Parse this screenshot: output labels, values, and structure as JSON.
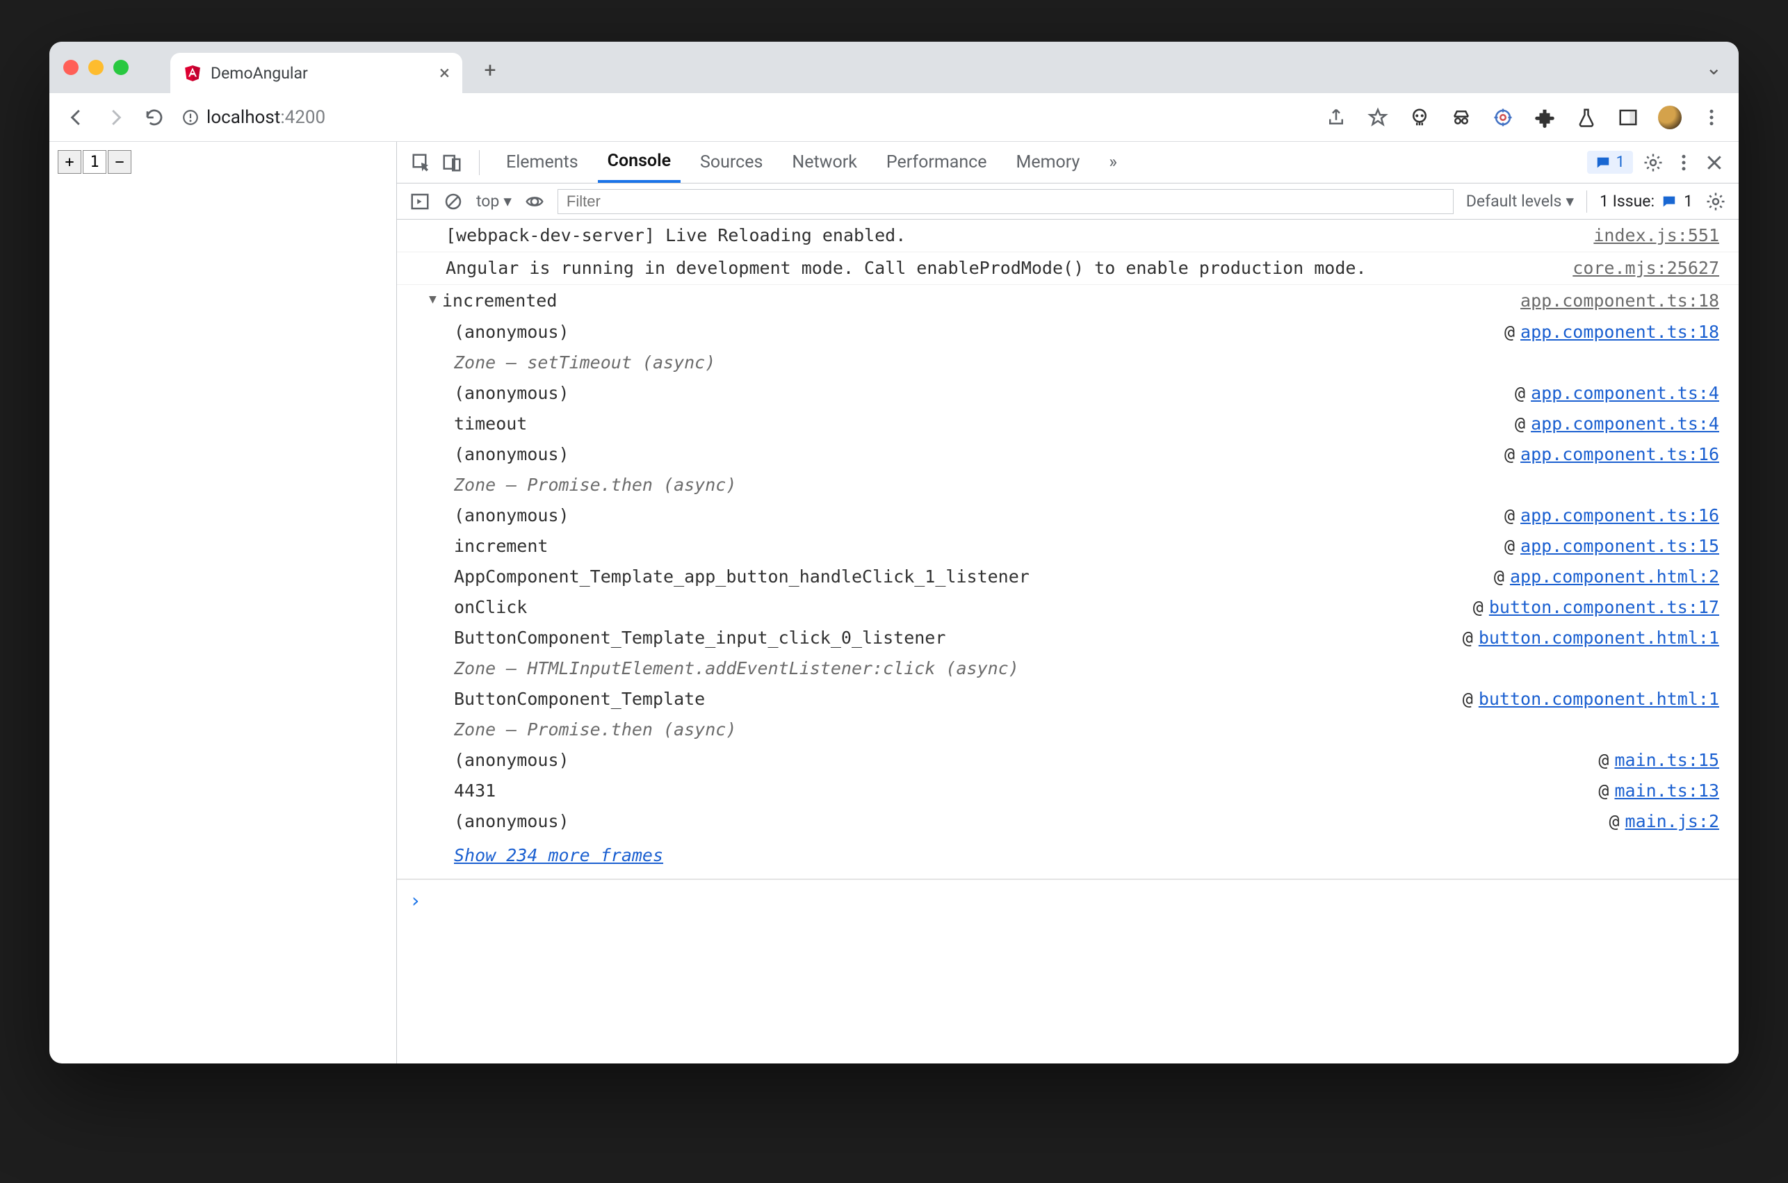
{
  "window": {
    "tab_title": "DemoAngular",
    "new_tab": "+",
    "close": "×",
    "collapse": "⌄"
  },
  "toolbar": {
    "url_prefix": "localhost",
    "url_suffix": ":4200"
  },
  "page": {
    "plus": "+",
    "value": "1",
    "minus": "−"
  },
  "devtools": {
    "tabs": [
      "Elements",
      "Console",
      "Sources",
      "Network",
      "Performance",
      "Memory"
    ],
    "active_tab": "Console",
    "more": "»",
    "msg_count": "1",
    "settings": "",
    "sub": {
      "context": "top",
      "filter_placeholder": "Filter",
      "levels": "Default levels",
      "issues_label": "1 Issue:",
      "issues_count": "1"
    },
    "log": [
      {
        "msg": "[webpack-dev-server] Live Reloading enabled.",
        "src": "index.js:551"
      },
      {
        "msg": "Angular is running in development mode. Call enableProdMode() to enable production mode.",
        "src": "core.mjs:25627"
      }
    ],
    "trace": {
      "title": "incremented",
      "src": "app.component.ts:18",
      "frames": [
        {
          "fn": "(anonymous)",
          "link": "app.component.ts:18"
        },
        {
          "note": "Zone — setTimeout (async)"
        },
        {
          "fn": "(anonymous)",
          "link": "app.component.ts:4"
        },
        {
          "fn": "timeout",
          "link": "app.component.ts:4"
        },
        {
          "fn": "(anonymous)",
          "link": "app.component.ts:16"
        },
        {
          "note": "Zone — Promise.then (async)"
        },
        {
          "fn": "(anonymous)",
          "link": "app.component.ts:16"
        },
        {
          "fn": "increment",
          "link": "app.component.ts:15"
        },
        {
          "fn": "AppComponent_Template_app_button_handleClick_1_listener",
          "link": "app.component.html:2"
        },
        {
          "fn": "onClick",
          "link": "button.component.ts:17"
        },
        {
          "fn": "ButtonComponent_Template_input_click_0_listener",
          "link": "button.component.html:1"
        },
        {
          "note": "Zone — HTMLInputElement.addEventListener:click (async)"
        },
        {
          "fn": "ButtonComponent_Template",
          "link": "button.component.html:1"
        },
        {
          "note": "Zone — Promise.then (async)"
        },
        {
          "fn": "(anonymous)",
          "link": "main.ts:15"
        },
        {
          "fn": "4431",
          "link": "main.ts:13"
        },
        {
          "fn": "(anonymous)",
          "link": "main.js:2"
        }
      ],
      "more": "Show 234 more frames"
    },
    "prompt": "›"
  }
}
